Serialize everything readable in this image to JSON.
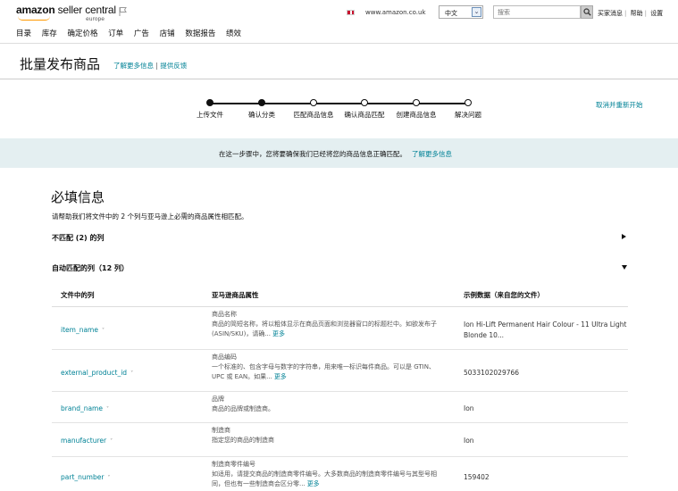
{
  "header": {
    "logo_main": "amazon",
    "logo_sc": "seller central",
    "logo_sub": "europe",
    "marketplace": "www.amazon.co.uk",
    "language": "中文",
    "search_placeholder": "搜索",
    "links": [
      "买家消息",
      "帮助",
      "设置"
    ]
  },
  "nav": [
    "目录",
    "库存",
    "确定价格",
    "订单",
    "广告",
    "店铺",
    "数据报告",
    "绩效"
  ],
  "page": {
    "title": "批量发布商品",
    "learn_more": "了解更多信息",
    "feedback": "提供反馈",
    "restart": "取消并重新开始"
  },
  "stepper": {
    "steps": [
      "上传文件",
      "确认分类",
      "匹配商品信息",
      "确认商品匹配",
      "创建商品信息",
      "解决问题"
    ],
    "completed": 2
  },
  "banner": {
    "text": "在这一步骤中，您将要确保我们已经将您的商品信息正确匹配。",
    "link": "了解更多信息"
  },
  "section": {
    "title": "必填信息",
    "desc": "请帮助我们将文件中的 2 个列与亚马逊上必需的商品属性相匹配。",
    "unmatched": "不匹配 (2) 的列",
    "matched": "自动匹配的列（12 列）"
  },
  "table": {
    "headers": [
      "文件中的列",
      "亚马逊商品属性",
      "示例数据（来自您的文件）"
    ],
    "more_label": "更多",
    "rows": [
      {
        "column": "item_name",
        "attr_name": "商品名称",
        "attr_desc": "商品的简短名称，将以粗体显示在商品页面和浏览器窗口的标题栏中。如欲发布子 (ASIN/SKU)，请确...",
        "sample": "Ion Hi-Lift Permanent Hair Colour - 11 Ultra Light Blonde 10..."
      },
      {
        "column": "external_product_id",
        "attr_name": "商品编码",
        "attr_desc": "一个标准的、包含字母与数字的字符串，用来唯一标识每件商品。可以是 GTIN、UPC 或 EAN。如果...",
        "sample": "5033102029766"
      },
      {
        "column": "brand_name",
        "attr_name": "品牌",
        "attr_desc": "商品的品牌或制造商。",
        "sample": "Ion"
      },
      {
        "column": "manufacturer",
        "attr_name": "制造商",
        "attr_desc": "指定您的商品的制造商",
        "sample": "Ion"
      },
      {
        "column": "part_number",
        "attr_name": "制造商零件编号",
        "attr_desc": "如适用，请提交商品的制造商零件编号。大多数商品的制造商零件编号与其型号相同，但也有一些制造商会区分零...",
        "sample": "159402"
      }
    ]
  }
}
